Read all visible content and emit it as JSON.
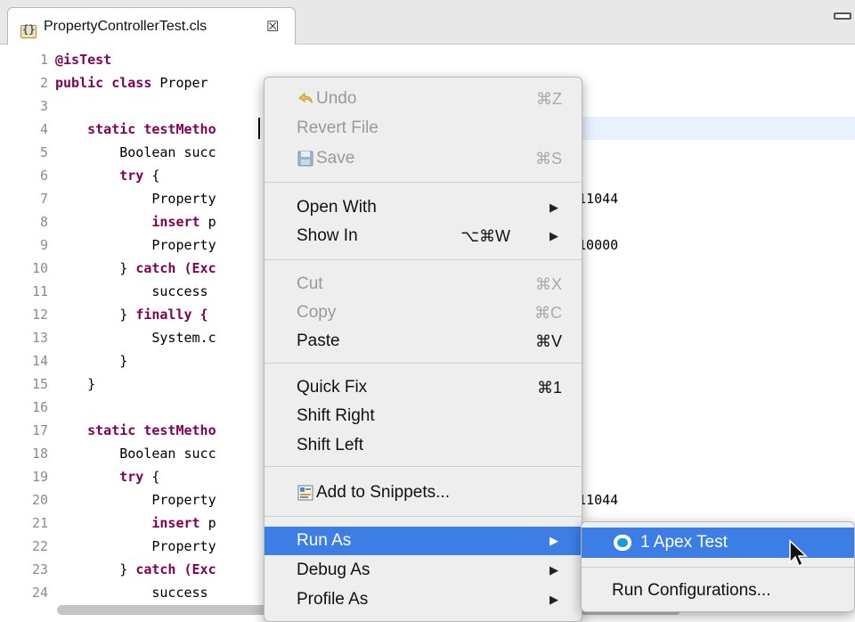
{
  "tab": {
    "title": "PropertyControllerTest.cls",
    "close_glyph": "☒"
  },
  "code": {
    "lines": [
      {
        "n": "1",
        "pre": "",
        "kw": "",
        "mid": "",
        "ann": "@isTest",
        "post": ""
      },
      {
        "n": "2",
        "pre": "",
        "kw": "public class ",
        "mid": "Proper",
        "ann": "",
        "post": ""
      },
      {
        "n": "3",
        "pre": "",
        "kw": "",
        "mid": "",
        "ann": "",
        "post": ""
      },
      {
        "n": "4",
        "pre": "    ",
        "kw": "static testMetho",
        "mid": "",
        "ann": "",
        "post": ""
      },
      {
        "n": "5",
        "pre": "        ",
        "kw": "",
        "mid": "Boolean succ",
        "ann": "",
        "post": ""
      },
      {
        "n": "6",
        "pre": "        ",
        "kw": "try",
        "mid": " {",
        "ann": "",
        "post": ""
      },
      {
        "n": "7",
        "pre": "            ",
        "kw": "",
        "mid": "Property",
        "ann": "",
        "post": "                        ion__Latitude__s=-71.11044"
      },
      {
        "n": "8",
        "pre": "            ",
        "kw": "insert",
        "mid": " p",
        "ann": "",
        "post": ""
      },
      {
        "n": "9",
        "pre": "            ",
        "kw": "",
        "mid": "Property",
        "ann": "",
        "post": "                        oller.findAll('', 0, 10000"
      },
      {
        "n": "10",
        "pre": "        ",
        "kw": "",
        "mid": "} ",
        "ann": "",
        "post": "catch (Exc"
      },
      {
        "n": "11",
        "pre": "            ",
        "kw": "",
        "mid": "success",
        "ann": "",
        "post": ""
      },
      {
        "n": "12",
        "pre": "        ",
        "kw": "",
        "mid": "} ",
        "ann": "",
        "post": "finally {"
      },
      {
        "n": "13",
        "pre": "            ",
        "kw": "",
        "mid": "System.c",
        "ann": "",
        "post": ""
      },
      {
        "n": "14",
        "pre": "        ",
        "kw": "",
        "mid": "}",
        "ann": "",
        "post": ""
      },
      {
        "n": "15",
        "pre": "    ",
        "kw": "",
        "mid": "}",
        "ann": "",
        "post": ""
      },
      {
        "n": "16",
        "pre": "",
        "kw": "",
        "mid": "",
        "ann": "",
        "post": ""
      },
      {
        "n": "17",
        "pre": "    ",
        "kw": "static testMetho",
        "mid": "",
        "ann": "",
        "post": ""
      },
      {
        "n": "18",
        "pre": "        ",
        "kw": "",
        "mid": "Boolean succ",
        "ann": "",
        "post": ""
      },
      {
        "n": "19",
        "pre": "        ",
        "kw": "try",
        "mid": " {",
        "ann": "",
        "post": ""
      },
      {
        "n": "20",
        "pre": "            ",
        "kw": "",
        "mid": "Property",
        "ann": "",
        "post": "                        ion__Latitude__s=-71.11044"
      },
      {
        "n": "21",
        "pre": "            ",
        "kw": "insert",
        "mid": " p",
        "ann": "",
        "post": ""
      },
      {
        "n": "22",
        "pre": "            ",
        "kw": "",
        "mid": "Property",
        "ann": "",
        "post": ""
      },
      {
        "n": "23",
        "pre": "        ",
        "kw": "",
        "mid": "} ",
        "ann": "",
        "post": "catch (Exc"
      },
      {
        "n": "24",
        "pre": "            ",
        "kw": "",
        "mid": "success",
        "ann": "",
        "post": ""
      }
    ]
  },
  "menu": {
    "undo": {
      "label": "Undo",
      "shortcut": "⌘Z"
    },
    "revert": {
      "label": "Revert File"
    },
    "save": {
      "label": "Save",
      "shortcut": "⌘S"
    },
    "open_with": {
      "label": "Open With"
    },
    "show_in": {
      "label": "Show In",
      "shortcut": "⌥⌘W"
    },
    "cut": {
      "label": "Cut",
      "shortcut": "⌘X"
    },
    "copy": {
      "label": "Copy",
      "shortcut": "⌘C"
    },
    "paste": {
      "label": "Paste",
      "shortcut": "⌘V"
    },
    "quick_fix": {
      "label": "Quick Fix",
      "shortcut": "⌘1"
    },
    "shift_right": {
      "label": "Shift Right"
    },
    "shift_left": {
      "label": "Shift Left"
    },
    "snippets": {
      "label": "Add to Snippets..."
    },
    "run_as": {
      "label": "Run As"
    },
    "debug_as": {
      "label": "Debug As"
    },
    "profile_as": {
      "label": "Profile As"
    },
    "arrow": "▶"
  },
  "submenu": {
    "apex_test": {
      "label": "1 Apex Test"
    },
    "run_configs": {
      "label": "Run Configurations..."
    }
  },
  "colors": {
    "highlight": "#3d7ee6",
    "keyword": "#7f0055",
    "current_line": "#e8f2fe"
  }
}
